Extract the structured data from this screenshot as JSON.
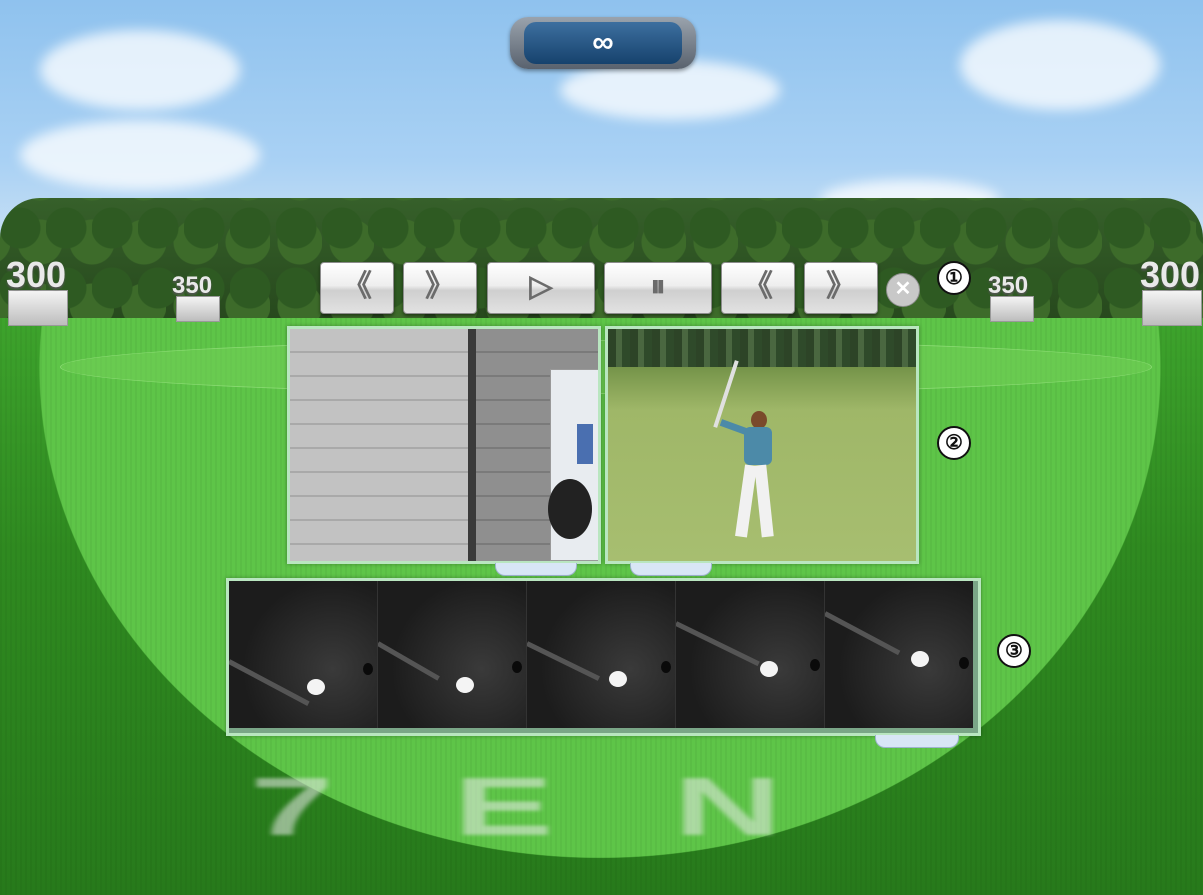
{
  "hud": {
    "counter_value": "∞"
  },
  "range_markers": {
    "far_left": "300",
    "left": "350",
    "right": "350",
    "far_right": "300",
    "ground_text": "7EN"
  },
  "toolbar": {
    "buttons": [
      {
        "id": "rewind-left",
        "icon": "double-chevron-left-icon",
        "glyph": "《"
      },
      {
        "id": "forward-right",
        "icon": "double-chevron-right-icon",
        "glyph": "》"
      },
      {
        "id": "play",
        "icon": "play-icon",
        "glyph": "▷"
      },
      {
        "id": "pause",
        "icon": "pause-icon",
        "glyph": "⏸"
      },
      {
        "id": "prev-frame",
        "icon": "double-chevron-left-icon",
        "glyph": "《"
      },
      {
        "id": "next-frame",
        "icon": "double-chevron-right-icon",
        "glyph": "》"
      }
    ],
    "close_glyph": "✕"
  },
  "callouts": {
    "one": "①",
    "two": "②",
    "three": "③"
  },
  "colors": {
    "panel_border": "#b9e6c0",
    "counter_bg": "#16426d",
    "grass": "#3da32c"
  }
}
